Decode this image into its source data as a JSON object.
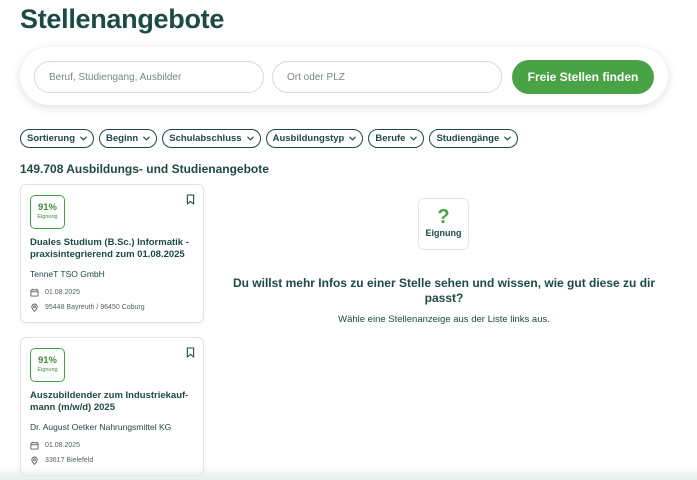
{
  "page": {
    "title": "Stellenangebote"
  },
  "search": {
    "job_placeholder": "Beruf, Studiengang, Ausbilder",
    "location_placeholder": "Ort oder PLZ",
    "submit_label": "Freie Stellen finden"
  },
  "filters": [
    {
      "label": "Sortierung"
    },
    {
      "label": "Beginn"
    },
    {
      "label": "Schulabschluss"
    },
    {
      "label": "Ausbildungstyp"
    },
    {
      "label": "Berufe"
    },
    {
      "label": "Studiengänge"
    }
  ],
  "results": {
    "count_text": "149.708 Ausbildungs- und Studienangebote",
    "items": [
      {
        "match": "91%",
        "match_label": "Eignung",
        "title": "Duales Studium (B.Sc.) Informatik - praxisintegrierend zum 01.08.2025",
        "company": "TenneT TSO GmbH",
        "date": "01.08.2025",
        "location": "95448 Bayreuth / 96450 Coburg"
      },
      {
        "match": "91%",
        "match_label": "Eignung",
        "title": "Auszubildender zum Industriekauf-mann (m/w/d) 2025",
        "company": "Dr. August Oetker Nahrungsmittel KG",
        "date": "01.08.2025",
        "location": "33617 Bielefeld"
      }
    ]
  },
  "detail": {
    "badge_symbol": "?",
    "badge_label": "Eignung",
    "heading": "Du willst mehr Infos zu einer Stelle sehen und wissen, wie gut diese zu dir passt?",
    "subtext": "Wähle eine Stellenanzeige aus der Liste links aus."
  },
  "colors": {
    "primary": "#1d4a45",
    "accent": "#4aa247"
  },
  "icons": {
    "chip": "chevron-down-icon",
    "save": "bookmark-icon",
    "date": "calendar-icon",
    "location": "location-pin-icon"
  }
}
